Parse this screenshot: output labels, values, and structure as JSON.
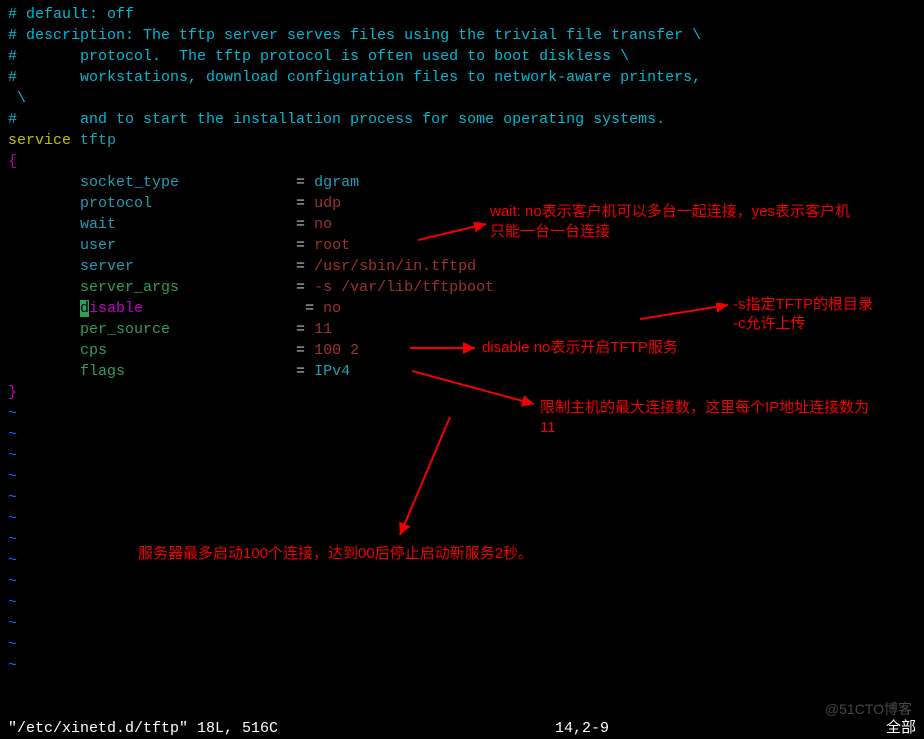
{
  "comments": {
    "c1": "# default: off",
    "c2": "# description: The tftp server serves files using the trivial file transfer \\",
    "c3": "#       protocol.  The tftp protocol is often used to boot diskless \\",
    "c4": "#       workstations, download configuration files to network-aware printers,",
    "c5": " \\",
    "c6": "#       and to start the installation process for some operating systems."
  },
  "service_kw": "service",
  "service_name": " tftp",
  "brace_open": "{",
  "brace_close": "}",
  "config": {
    "socket_type": {
      "key": "        socket_type            ",
      "eq": " = ",
      "val": "dgram"
    },
    "protocol": {
      "key": "        protocol               ",
      "eq": " = ",
      "val": "udp"
    },
    "wait": {
      "key": "        wait                   ",
      "eq": " = ",
      "val": "no"
    },
    "user": {
      "key": "        user                   ",
      "eq": " = ",
      "val": "root"
    },
    "server": {
      "key": "        server                 ",
      "eq": " = ",
      "val": "/usr/sbin/in.tftpd"
    },
    "server_args": {
      "key": "        server_args            ",
      "eq": " = ",
      "val": "-s /var/lib/tftpboot"
    },
    "disable": {
      "pad": "        ",
      "first": "d",
      "rest": "isable                 ",
      "eq": " = ",
      "val": "no"
    },
    "per_source": {
      "key": "        per_source             ",
      "eq": " = ",
      "val": "11"
    },
    "cps": {
      "key": "        cps                    ",
      "eq": " = ",
      "val": "100 2"
    },
    "flags": {
      "key": "        flags                  ",
      "eq": " = ",
      "val": "IPv4"
    }
  },
  "tilde": "~",
  "annotations": {
    "wait_note": "wait: no表示客户机可以多台一起连接，yes表示客户机只能一台一台连接",
    "s_note": "-s指定TFTP的根目录",
    "c_note": "-c允许上传",
    "disable_note": "disable no表示开启TFTP服务",
    "per_source_note": "限制主机的最大连接数，这里每个IP地址连接数为11",
    "cps_note": "服务器最多启动100个连接，达到00后停止启动新服务2秒。"
  },
  "statusbar": {
    "left": "\"/etc/xinetd.d/tftp\" 18L, 516C",
    "mid": "14,2-9",
    "right": "全部"
  },
  "watermark": "@51CTO博客"
}
